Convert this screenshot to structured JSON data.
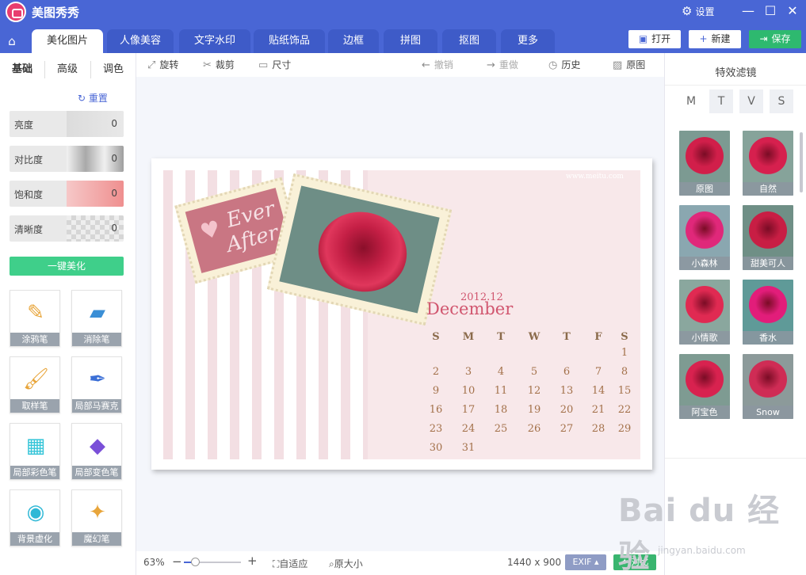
{
  "app": {
    "title": "美图秀秀",
    "settings": "设置"
  },
  "tabs": [
    "美化图片",
    "人像美容",
    "文字水印",
    "贴纸饰品",
    "边框",
    "拼图",
    "抠图",
    "更多"
  ],
  "top_buttons": {
    "open": "打开",
    "new": "新建",
    "save": "保存"
  },
  "left_tabs": [
    "基础",
    "高级",
    "调色"
  ],
  "reset": "重置",
  "sliders": [
    {
      "label": "亮度",
      "value": "0"
    },
    {
      "label": "对比度",
      "value": "0"
    },
    {
      "label": "饱和度",
      "value": "0"
    },
    {
      "label": "清晰度",
      "value": "0"
    }
  ],
  "one_key": "一键美化",
  "tools": [
    "涂鸦笔",
    "消除笔",
    "取样笔",
    "局部马赛克",
    "局部彩色笔",
    "局部变色笔",
    "背景虚化",
    "魔幻笔"
  ],
  "toolbar": {
    "rotate": "旋转",
    "crop": "裁剪",
    "size": "尺寸",
    "undo": "撤销",
    "redo": "重做",
    "history": "历史",
    "original": "原图"
  },
  "canvas": {
    "watermark": "www.meitu.com",
    "stamp_line1": "Ever",
    "stamp_line2": "After",
    "year": "2012.12",
    "month": "December",
    "weekdays": [
      "S",
      "M",
      "T",
      "W",
      "T",
      "F",
      "S"
    ],
    "days": [
      "1",
      "2",
      "3",
      "4",
      "5",
      "6",
      "7",
      "8",
      "9",
      "10",
      "11",
      "12",
      "13",
      "14",
      "15",
      "16",
      "17",
      "18",
      "19",
      "20",
      "21",
      "22",
      "23",
      "24",
      "25",
      "26",
      "27",
      "28",
      "29",
      "30",
      "31"
    ]
  },
  "status": {
    "zoom": "63%",
    "fit": "自适应",
    "actual": "原大小",
    "dimensions": "1440 x 900",
    "exif": "EXIF",
    "compare": "对比"
  },
  "filters": {
    "title": "特效滤镜",
    "tabs": [
      "M",
      "T",
      "V",
      "S"
    ],
    "items": [
      "原图",
      "自然",
      "小森林",
      "甜美可人",
      "小情歌",
      "香水",
      "阿宝色",
      "Snow"
    ]
  },
  "watermark_site": {
    "brand": "Bai du 经验",
    "url": "jingyan.baidu.com"
  }
}
